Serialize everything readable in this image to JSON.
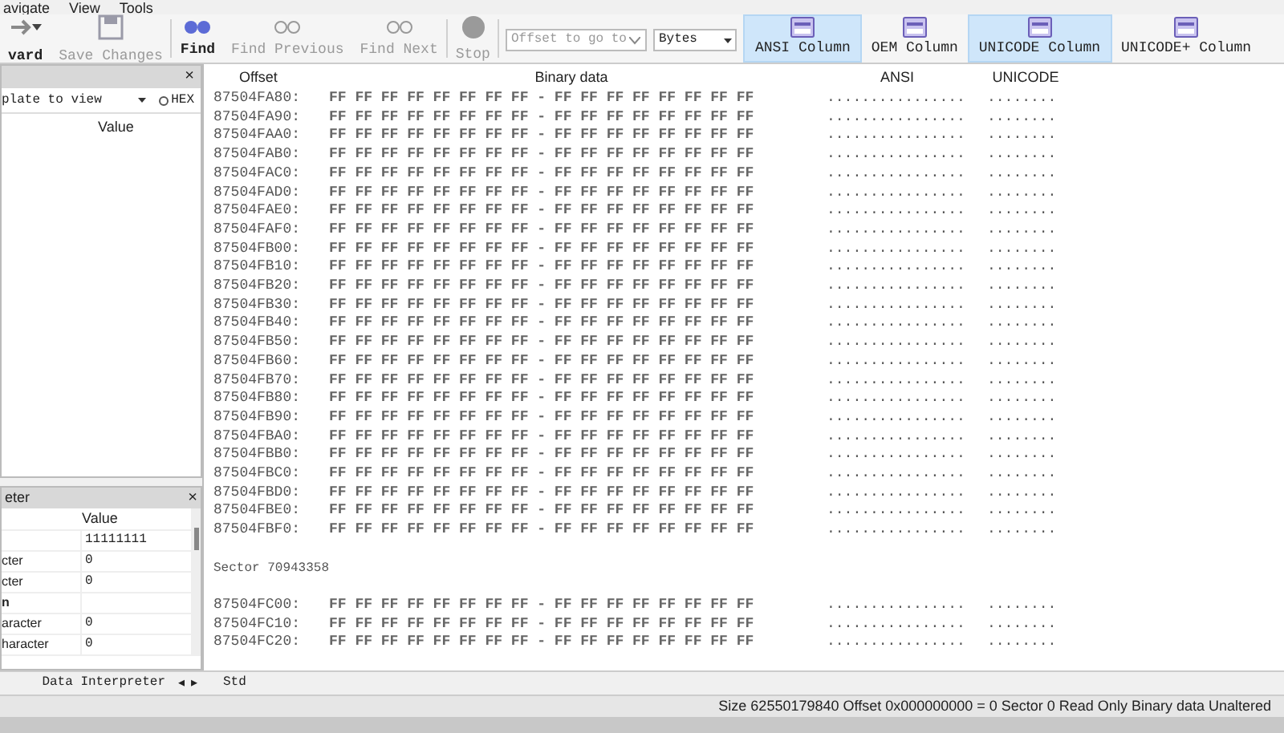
{
  "menu": [
    {
      "label": "avigate"
    },
    {
      "label": "View"
    },
    {
      "label": "Tools"
    }
  ],
  "toolbar": [
    {
      "kind": "button",
      "label": "vard",
      "disabled": false,
      "caret": true
    },
    {
      "kind": "button",
      "label": "Save Changes",
      "disabled": true,
      "caret": false
    },
    {
      "kind": "button",
      "label": "Find",
      "disabled": false,
      "caret": false
    },
    {
      "kind": "button",
      "label": "Find Previous",
      "disabled": true,
      "caret": false
    },
    {
      "kind": "button",
      "label": "Find Next",
      "disabled": true,
      "caret": false
    },
    {
      "kind": "button",
      "label": "Stop",
      "disabled": true,
      "caret": false
    }
  ],
  "offset_field": {
    "placeholder": "Offset to go to"
  },
  "unit_select": {
    "value": "Bytes"
  },
  "column_toggles": [
    {
      "label": "ANSI Column",
      "selected": true
    },
    {
      "label": "OEM Column",
      "selected": false
    },
    {
      "label": "UNICODE Column",
      "selected": true
    },
    {
      "label": "UNICODE+ Column",
      "selected": false
    }
  ],
  "template_panel": {
    "close": "×",
    "select": "plate to view",
    "hex_option": "HEX",
    "hex_selected": false,
    "column": "Value"
  },
  "interpreter_panel": {
    "title": "eter",
    "close": "×",
    "column": "Value",
    "rows": [
      {
        "kind": "field",
        "value": "11111111"
      },
      {
        "kind": "field",
        "name": "cter",
        "value": "0"
      },
      {
        "kind": "field",
        "name": "cter",
        "value": "0"
      },
      {
        "kind": "heading",
        "name": "n"
      },
      {
        "kind": "field",
        "name": "aracter",
        "value": "0"
      },
      {
        "kind": "field",
        "name": "haracter",
        "value": "0"
      }
    ]
  },
  "left_tab": {
    "label": "Data Interpreter",
    "prev": "◂",
    "next": "▸"
  },
  "hex_view": {
    "columns": [
      "Offset",
      "Binary data",
      "ANSI",
      "UNICODE"
    ],
    "lines": [
      {
        "kind": "row",
        "offset": "87504FA80:",
        "bytes": "FF FF FF FF FF FF FF FF - FF FF FF FF FF FF FF FF",
        "ansi": "................",
        "unicode": "........"
      },
      {
        "kind": "row",
        "offset": "87504FA90:",
        "bytes": "FF FF FF FF FF FF FF FF - FF FF FF FF FF FF FF FF",
        "ansi": "................",
        "unicode": "........"
      },
      {
        "kind": "row",
        "offset": "87504FAA0:",
        "bytes": "FF FF FF FF FF FF FF FF - FF FF FF FF FF FF FF FF",
        "ansi": "................",
        "unicode": "........"
      },
      {
        "kind": "row",
        "offset": "87504FAB0:",
        "bytes": "FF FF FF FF FF FF FF FF - FF FF FF FF FF FF FF FF",
        "ansi": "................",
        "unicode": "........"
      },
      {
        "kind": "row",
        "offset": "87504FAC0:",
        "bytes": "FF FF FF FF FF FF FF FF - FF FF FF FF FF FF FF FF",
        "ansi": "................",
        "unicode": "........"
      },
      {
        "kind": "row",
        "offset": "87504FAD0:",
        "bytes": "FF FF FF FF FF FF FF FF - FF FF FF FF FF FF FF FF",
        "ansi": "................",
        "unicode": "........"
      },
      {
        "kind": "row",
        "offset": "87504FAE0:",
        "bytes": "FF FF FF FF FF FF FF FF - FF FF FF FF FF FF FF FF",
        "ansi": "................",
        "unicode": "........"
      },
      {
        "kind": "row",
        "offset": "87504FAF0:",
        "bytes": "FF FF FF FF FF FF FF FF - FF FF FF FF FF FF FF FF",
        "ansi": "................",
        "unicode": "........"
      },
      {
        "kind": "row",
        "offset": "87504FB00:",
        "bytes": "FF FF FF FF FF FF FF FF - FF FF FF FF FF FF FF FF",
        "ansi": "................",
        "unicode": "........"
      },
      {
        "kind": "row",
        "offset": "87504FB10:",
        "bytes": "FF FF FF FF FF FF FF FF - FF FF FF FF FF FF FF FF",
        "ansi": "................",
        "unicode": "........"
      },
      {
        "kind": "row",
        "offset": "87504FB20:",
        "bytes": "FF FF FF FF FF FF FF FF - FF FF FF FF FF FF FF FF",
        "ansi": "................",
        "unicode": "........"
      },
      {
        "kind": "row",
        "offset": "87504FB30:",
        "bytes": "FF FF FF FF FF FF FF FF - FF FF FF FF FF FF FF FF",
        "ansi": "................",
        "unicode": "........"
      },
      {
        "kind": "row",
        "offset": "87504FB40:",
        "bytes": "FF FF FF FF FF FF FF FF - FF FF FF FF FF FF FF FF",
        "ansi": "................",
        "unicode": "........"
      },
      {
        "kind": "row",
        "offset": "87504FB50:",
        "bytes": "FF FF FF FF FF FF FF FF - FF FF FF FF FF FF FF FF",
        "ansi": "................",
        "unicode": "........"
      },
      {
        "kind": "row",
        "offset": "87504FB60:",
        "bytes": "FF FF FF FF FF FF FF FF - FF FF FF FF FF FF FF FF",
        "ansi": "................",
        "unicode": "........"
      },
      {
        "kind": "row",
        "offset": "87504FB70:",
        "bytes": "FF FF FF FF FF FF FF FF - FF FF FF FF FF FF FF FF",
        "ansi": "................",
        "unicode": "........"
      },
      {
        "kind": "row",
        "offset": "87504FB80:",
        "bytes": "FF FF FF FF FF FF FF FF - FF FF FF FF FF FF FF FF",
        "ansi": "................",
        "unicode": "........"
      },
      {
        "kind": "row",
        "offset": "87504FB90:",
        "bytes": "FF FF FF FF FF FF FF FF - FF FF FF FF FF FF FF FF",
        "ansi": "................",
        "unicode": "........"
      },
      {
        "kind": "row",
        "offset": "87504FBA0:",
        "bytes": "FF FF FF FF FF FF FF FF - FF FF FF FF FF FF FF FF",
        "ansi": "................",
        "unicode": "........"
      },
      {
        "kind": "row",
        "offset": "87504FBB0:",
        "bytes": "FF FF FF FF FF FF FF FF - FF FF FF FF FF FF FF FF",
        "ansi": "................",
        "unicode": "........"
      },
      {
        "kind": "row",
        "offset": "87504FBC0:",
        "bytes": "FF FF FF FF FF FF FF FF - FF FF FF FF FF FF FF FF",
        "ansi": "................",
        "unicode": "........"
      },
      {
        "kind": "row",
        "offset": "87504FBD0:",
        "bytes": "FF FF FF FF FF FF FF FF - FF FF FF FF FF FF FF FF",
        "ansi": "................",
        "unicode": "........"
      },
      {
        "kind": "row",
        "offset": "87504FBE0:",
        "bytes": "FF FF FF FF FF FF FF FF - FF FF FF FF FF FF FF FF",
        "ansi": "................",
        "unicode": "........"
      },
      {
        "kind": "row",
        "offset": "87504FBF0:",
        "bytes": "FF FF FF FF FF FF FF FF - FF FF FF FF FF FF FF FF",
        "ansi": "................",
        "unicode": "........"
      },
      {
        "kind": "sector",
        "label": "Sector 70943358"
      },
      {
        "kind": "row",
        "offset": "87504FC00:",
        "bytes": "FF FF FF FF FF FF FF FF - FF FF FF FF FF FF FF FF",
        "ansi": "................",
        "unicode": "........"
      },
      {
        "kind": "row",
        "offset": "87504FC10:",
        "bytes": "FF FF FF FF FF FF FF FF - FF FF FF FF FF FF FF FF",
        "ansi": "................",
        "unicode": "........"
      },
      {
        "kind": "row",
        "offset": "87504FC20:",
        "bytes": "FF FF FF FF FF FF FF FF - FF FF FF FF FF FF FF FF",
        "ansi": "................",
        "unicode": "........"
      }
    ]
  },
  "view_tab": {
    "label": "Std"
  },
  "status_bar": {
    "text": "Size 62550179840 Offset 0x000000000 = 0 Sector 0 Read Only Binary data Unaltered"
  }
}
